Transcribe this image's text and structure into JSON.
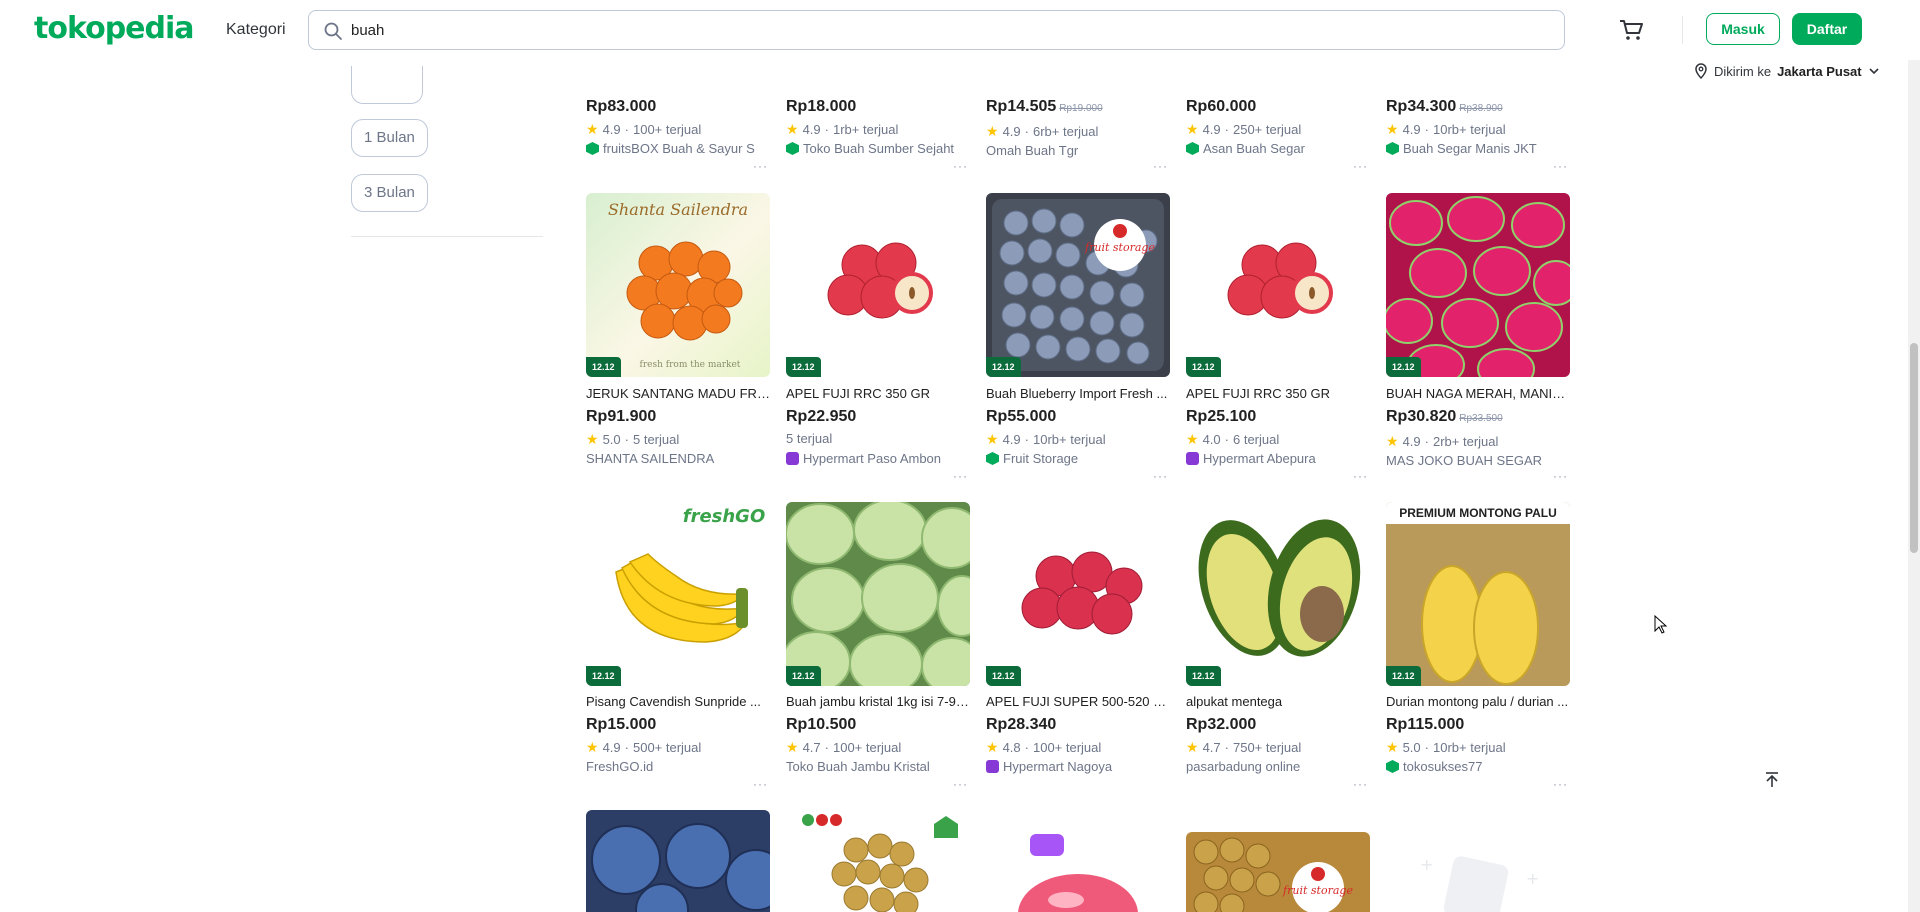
{
  "header": {
    "logo": "tokopedia",
    "kategori": "Kategori",
    "search_value": "buah",
    "masuk_label": "Masuk",
    "daftar_label": "Daftar",
    "location_prefix": "Dikirim ke",
    "location_city": "Jakarta Pusat"
  },
  "sidebar": {
    "chips": [
      "1 Bulan",
      "3 Bulan"
    ]
  },
  "rows": [
    {
      "products": [
        {
          "price": "Rp83.000",
          "old_price": "",
          "rating": "4.9",
          "sold": "100+ terjual",
          "shop": "fruitsBOX Buah & Sayur S",
          "badge": "green"
        },
        {
          "price": "Rp18.000",
          "old_price": "",
          "rating": "4.9",
          "sold": "1rb+ terjual",
          "shop": "Toko Buah Sumber Sejaht",
          "badge": "green"
        },
        {
          "price": "Rp14.505",
          "old_price": "Rp19.000",
          "rating": "4.9",
          "sold": "6rb+ terjual",
          "shop": "Omah Buah Tgr",
          "badge": ""
        },
        {
          "price": "Rp60.000",
          "old_price": "",
          "rating": "4.9",
          "sold": "250+ terjual",
          "shop": "Asan Buah Segar",
          "badge": "green"
        },
        {
          "price": "Rp34.300",
          "old_price": "Rp38.900",
          "rating": "4.9",
          "sold": "10rb+ terjual",
          "shop": "Buah Segar Manis JKT",
          "badge": "green"
        }
      ]
    },
    {
      "products": [
        {
          "name": "JERUK SANTANG MADU FRES...",
          "price": "Rp91.900",
          "old_price": "",
          "rating": "5.0",
          "sold": "5 terjual",
          "shop": "SHANTA SAILENDRA",
          "badge": "",
          "img": "oranges"
        },
        {
          "name": "APEL FUJI RRC 350 GR",
          "price": "Rp22.950",
          "old_price": "",
          "rating": "",
          "sold": "5 terjual",
          "shop": "Hypermart Paso Ambon",
          "badge": "purple",
          "img": "apples"
        },
        {
          "name": "Buah Blueberry Import Fresh ...",
          "price": "Rp55.000",
          "old_price": "",
          "rating": "4.9",
          "sold": "10rb+ terjual",
          "shop": "Fruit Storage",
          "badge": "green",
          "img": "blueberry"
        },
        {
          "name": "APEL FUJI RRC 350 GR",
          "price": "Rp25.100",
          "old_price": "",
          "rating": "4.0",
          "sold": "6 terjual",
          "shop": "Hypermart Abepura",
          "badge": "purple",
          "img": "apples"
        },
        {
          "name": "BUAH NAGA MERAH, MANIS, ...",
          "price": "Rp30.820",
          "old_price": "Rp33.500",
          "rating": "4.9",
          "sold": "2rb+ terjual",
          "shop": "MAS JOKO BUAH SEGAR",
          "badge": "",
          "img": "dragon"
        }
      ]
    },
    {
      "products": [
        {
          "name": "Pisang Cavendish Sunpride ...",
          "price": "Rp15.000",
          "old_price": "",
          "rating": "4.9",
          "sold": "500+ terjual",
          "shop": "FreshGO.id",
          "badge": "",
          "img": "banana"
        },
        {
          "name": "Buah jambu kristal 1kg isi 7-9 ...",
          "price": "Rp10.500",
          "old_price": "",
          "rating": "4.7",
          "sold": "100+ terjual",
          "shop": "Toko Buah Jambu Kristal",
          "badge": "",
          "img": "guava"
        },
        {
          "name": "APEL FUJI SUPER 500-520 GR",
          "price": "Rp28.340",
          "old_price": "",
          "rating": "4.8",
          "sold": "100+ terjual",
          "shop": "Hypermart Nagoya",
          "badge": "purple",
          "img": "redapples"
        },
        {
          "name": "alpukat mentega",
          "price": "Rp32.000",
          "old_price": "",
          "rating": "4.7",
          "sold": "750+ terjual",
          "shop": "pasarbadung online",
          "badge": "",
          "img": "avocado"
        },
        {
          "name": "Durian montong palu / durian ...",
          "price": "Rp115.000",
          "old_price": "",
          "rating": "5.0",
          "sold": "10rb+ terjual",
          "shop": "tokosukses77",
          "badge": "green",
          "img": "durian"
        }
      ]
    }
  ],
  "image_text": {
    "shanta": "Shanta Sailendra",
    "shanta_sub": "fresh from the market",
    "freshgo": "freshGO",
    "premium": "PREMIUM MONTONG PALU",
    "fruit_storage": "fruit storage",
    "badge_1212": "12.12"
  },
  "colors": {
    "brand": "#00AA5B",
    "star": "#FFC400",
    "power_merchant": "#00AA5B",
    "official_store": "#8739D5"
  }
}
